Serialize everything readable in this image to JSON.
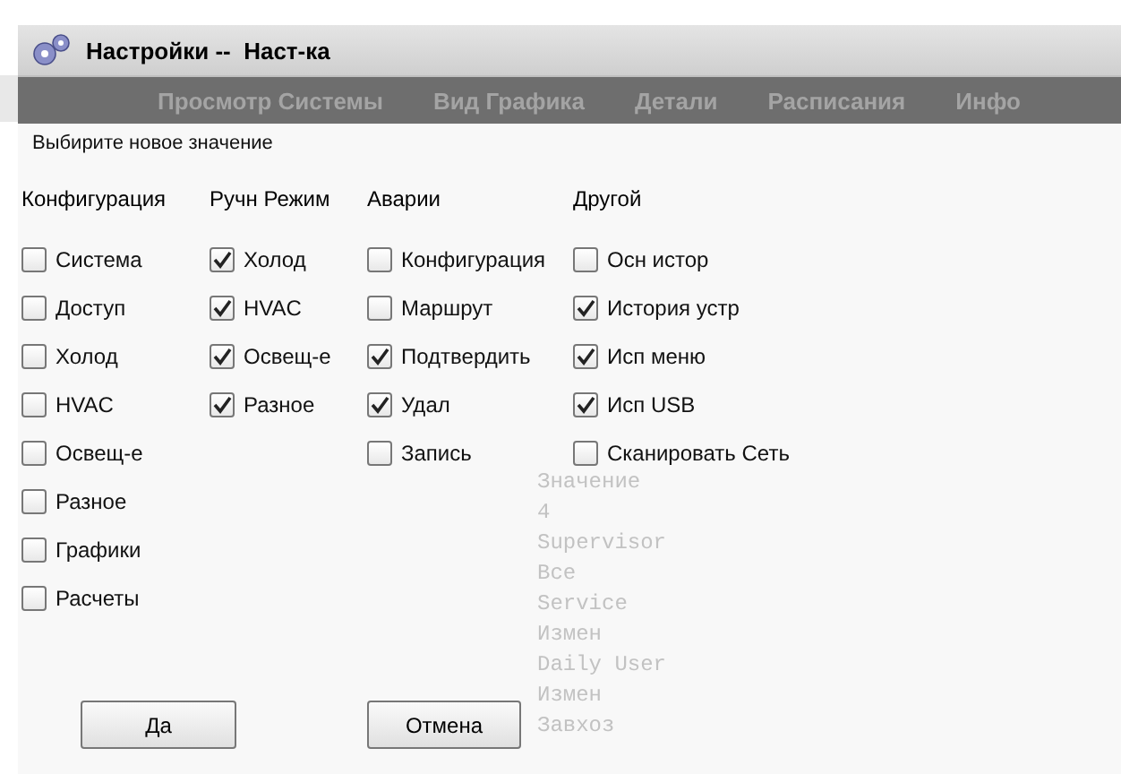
{
  "background": {
    "nav": [
      "Просмотр Системы",
      "Вид Графика",
      "Детали",
      "Расписания",
      "Инфо"
    ],
    "list": [
      "Значение",
      "4",
      "Supervisor",
      "Все",
      "Service",
      "Измен",
      "Daily User",
      "Измен",
      "Завхоз"
    ]
  },
  "dialog": {
    "title": "Настройки --  Наст-ка",
    "prompt": "Выбирите новое значение",
    "columns": [
      {
        "heading": "Конфигурация",
        "items": [
          {
            "label": "Система",
            "checked": false
          },
          {
            "label": "Доступ",
            "checked": false
          },
          {
            "label": "Холод",
            "checked": false
          },
          {
            "label": "HVAC",
            "checked": false
          },
          {
            "label": "Освещ-е",
            "checked": false
          },
          {
            "label": "Разное",
            "checked": false
          },
          {
            "label": "Графики",
            "checked": false
          },
          {
            "label": "Расчеты",
            "checked": false
          }
        ]
      },
      {
        "heading": "Ручн Режим",
        "items": [
          {
            "label": "Холод",
            "checked": true
          },
          {
            "label": "HVAC",
            "checked": true
          },
          {
            "label": "Освещ-е",
            "checked": true
          },
          {
            "label": "Разное",
            "checked": true
          }
        ]
      },
      {
        "heading": "Аварии",
        "items": [
          {
            "label": "Конфигурация",
            "checked": false
          },
          {
            "label": "Маршрут",
            "checked": false
          },
          {
            "label": "Подтвердить",
            "checked": true
          },
          {
            "label": "Удал",
            "checked": true
          },
          {
            "label": "Запись",
            "checked": false
          }
        ]
      },
      {
        "heading": "Другой",
        "items": [
          {
            "label": "Осн истор",
            "checked": false
          },
          {
            "label": "История устр",
            "checked": true
          },
          {
            "label": "Исп меню",
            "checked": true
          },
          {
            "label": "Исп USB",
            "checked": true
          },
          {
            "label": "Сканировать Сеть",
            "checked": false
          }
        ]
      }
    ],
    "buttons": [
      "Да",
      "Отмена"
    ]
  }
}
